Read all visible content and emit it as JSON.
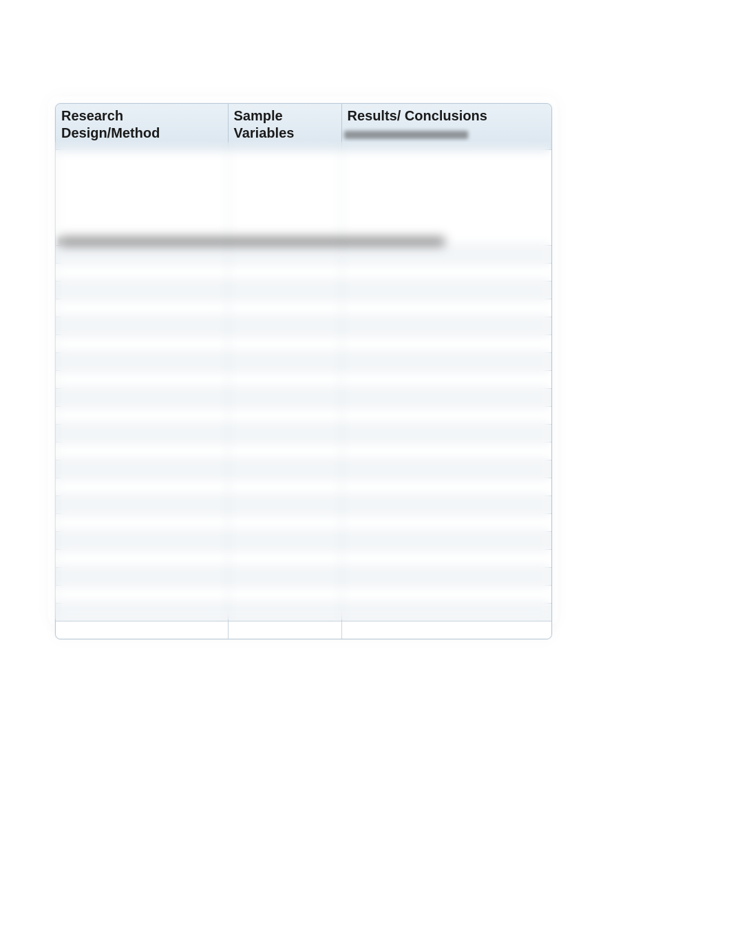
{
  "table": {
    "headers": {
      "col1": "Research Design/Method",
      "col2": "Sample Variables",
      "col3": "Results/ Conclusions"
    },
    "body_row_count": 23
  }
}
